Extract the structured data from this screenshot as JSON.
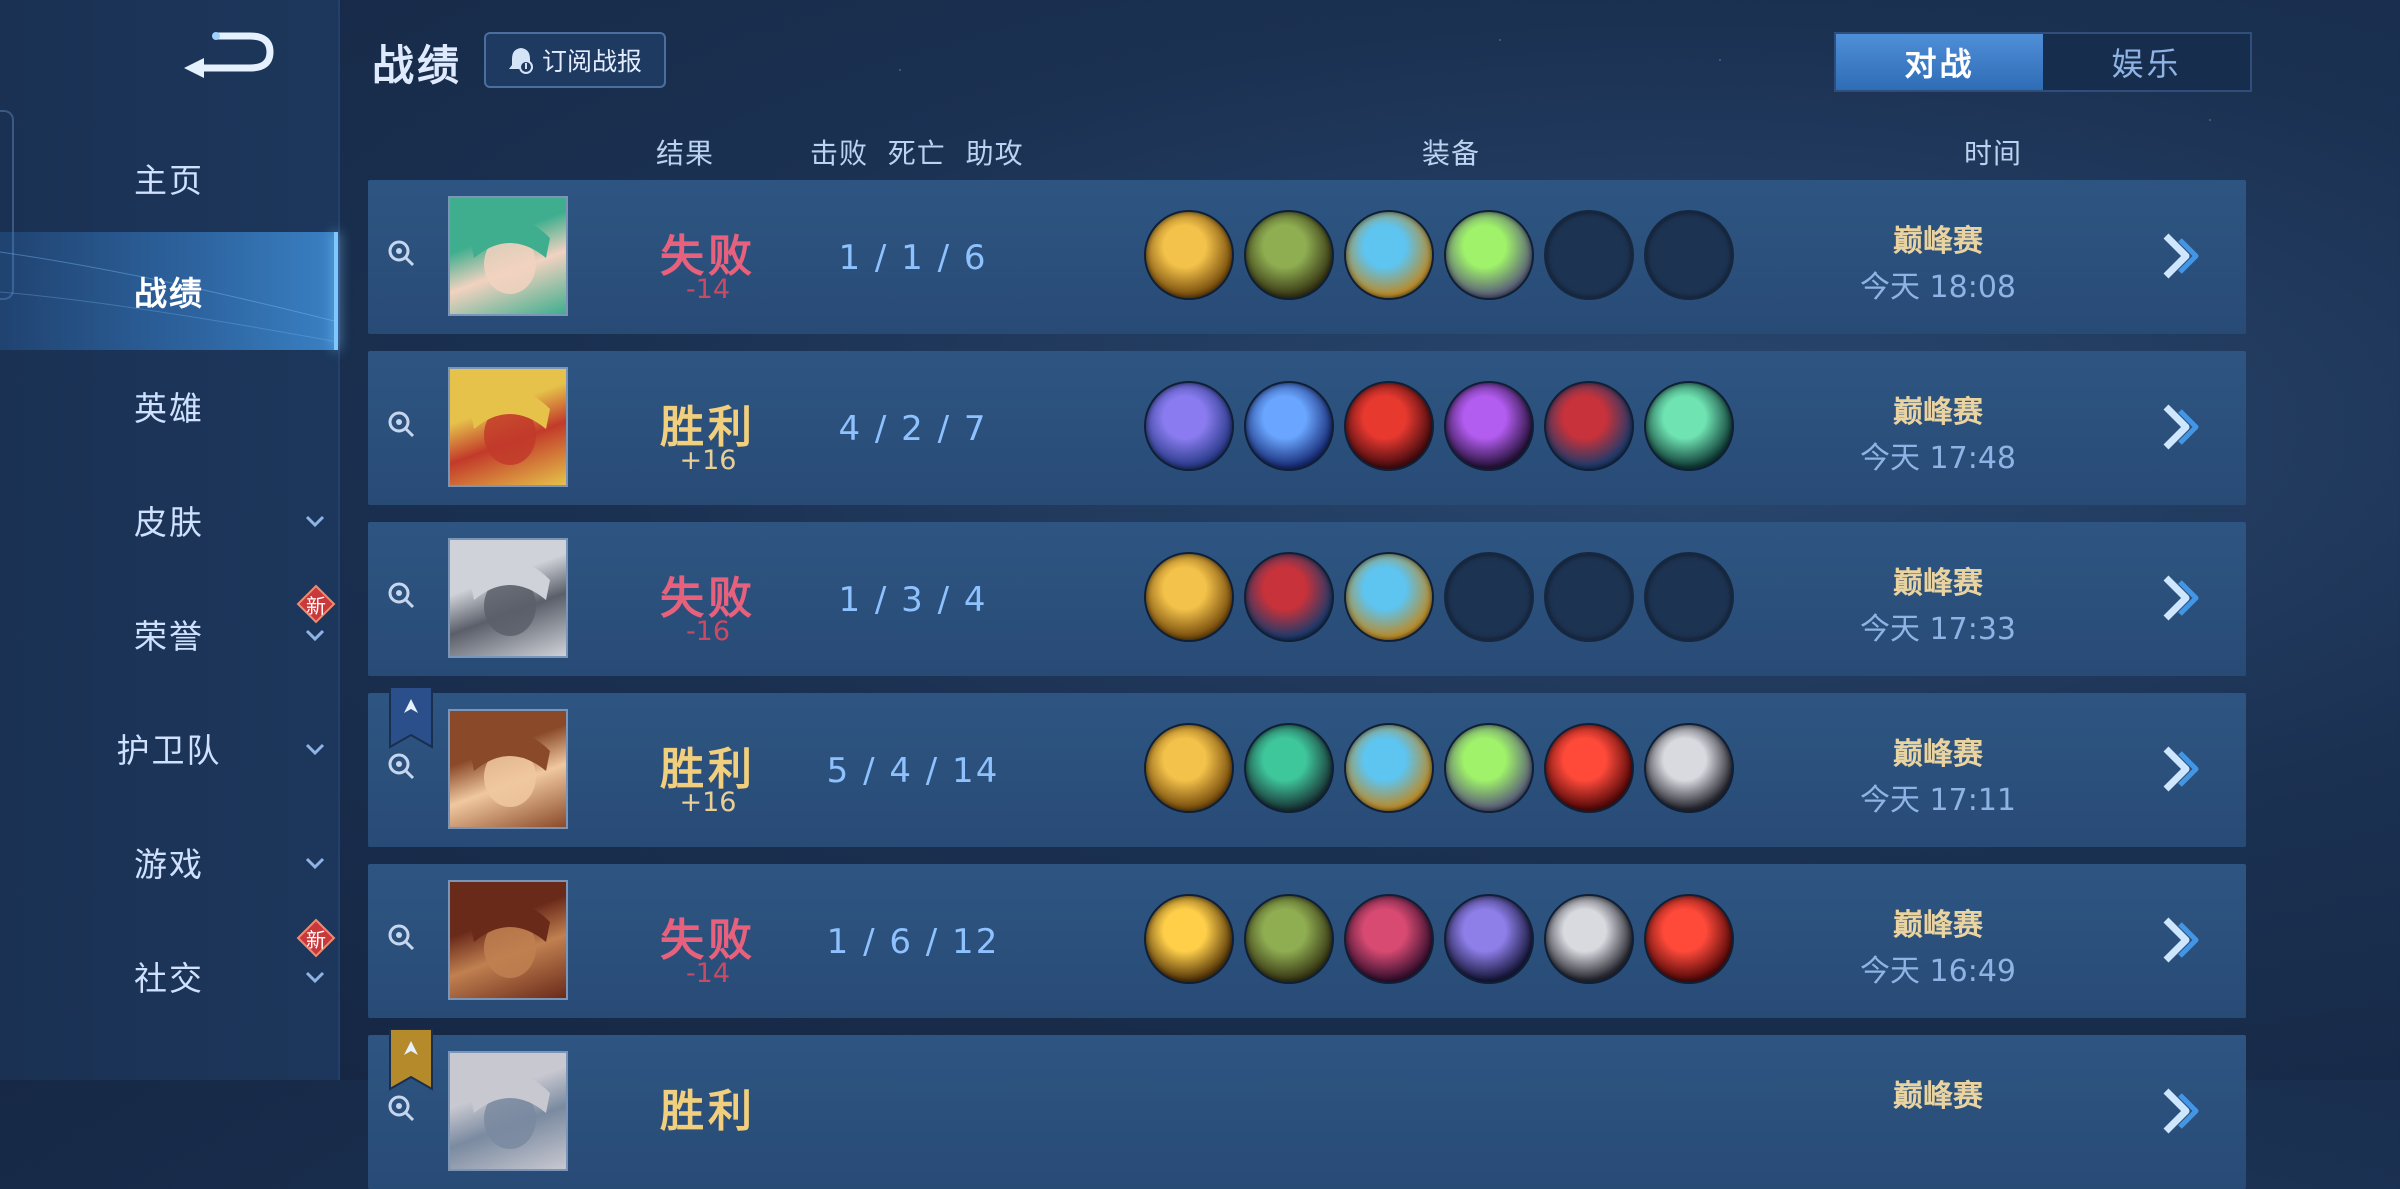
{
  "page": {
    "title": "战绩",
    "subscribe_label": "订阅战报"
  },
  "tabs": [
    {
      "label": "对战",
      "active": true
    },
    {
      "label": "娱乐",
      "active": false
    }
  ],
  "sidebar": {
    "items": [
      {
        "label": "主页"
      },
      {
        "label": "战绩",
        "active": true
      },
      {
        "label": "英雄"
      },
      {
        "label": "皮肤",
        "expandable": true
      },
      {
        "label": "荣誉",
        "expandable": true,
        "badge": "新"
      },
      {
        "label": "护卫队",
        "expandable": true
      },
      {
        "label": "游戏",
        "expandable": true
      },
      {
        "label": "社交",
        "expandable": true,
        "badge": "新"
      }
    ]
  },
  "columns": {
    "result": "结果",
    "kda": "击败  死亡  助攻",
    "items": "装备",
    "time": "时间"
  },
  "matches": [
    {
      "result": "失败",
      "outcome": "lose",
      "delta": "-14",
      "kda": "1 / 1 / 6",
      "mode": "巅峰赛",
      "time": "今天 18:08",
      "items": [
        "gold-shield-icon",
        "green-boots-icon",
        "blue-gold-amulet-icon",
        "green-winged-armor-icon",
        "empty",
        "empty"
      ]
    },
    {
      "result": "胜利",
      "outcome": "win",
      "delta": "+16",
      "kda": "4 / 2 / 7",
      "mode": "巅峰赛",
      "time": "今天 17:48",
      "items": [
        "purple-axe-icon",
        "blue-spear-icon",
        "red-helmet-icon",
        "dark-purple-blade-icon",
        "red-boots-icon",
        "jade-sword-icon"
      ]
    },
    {
      "result": "失败",
      "outcome": "lose",
      "delta": "-16",
      "kda": "1 / 3 / 4",
      "mode": "巅峰赛",
      "time": "今天 17:33",
      "items": [
        "gold-shield-icon",
        "red-boots-icon",
        "blue-gold-amulet-icon",
        "empty",
        "empty",
        "empty"
      ]
    },
    {
      "result": "胜利",
      "outcome": "win",
      "delta": "+16",
      "kda": "5 / 4 / 14",
      "mode": "巅峰赛",
      "time": "今天 17:11",
      "items": [
        "gold-shield-icon",
        "teal-boots-icon",
        "blue-gold-amulet-icon",
        "green-winged-armor-icon",
        "red-gem-icon",
        "steel-armor-icon"
      ]
    },
    {
      "result": "失败",
      "outcome": "lose",
      "delta": "-14",
      "kda": "1 / 6 / 12",
      "mode": "巅峰赛",
      "time": "今天 16:49",
      "items": [
        "gold-armor-icon",
        "green-boots-icon",
        "crimson-helmet-icon",
        "violet-armor-icon",
        "steel-armor-icon",
        "red-gem-icon"
      ]
    },
    {
      "result": "胜利",
      "outcome": "win",
      "delta": "",
      "kda": "",
      "mode": "巅峰赛",
      "time": "",
      "items": []
    }
  ],
  "colors": {
    "lose": "#e8617c",
    "win": "#f1cf7c",
    "accent": "#4f8fd8"
  }
}
